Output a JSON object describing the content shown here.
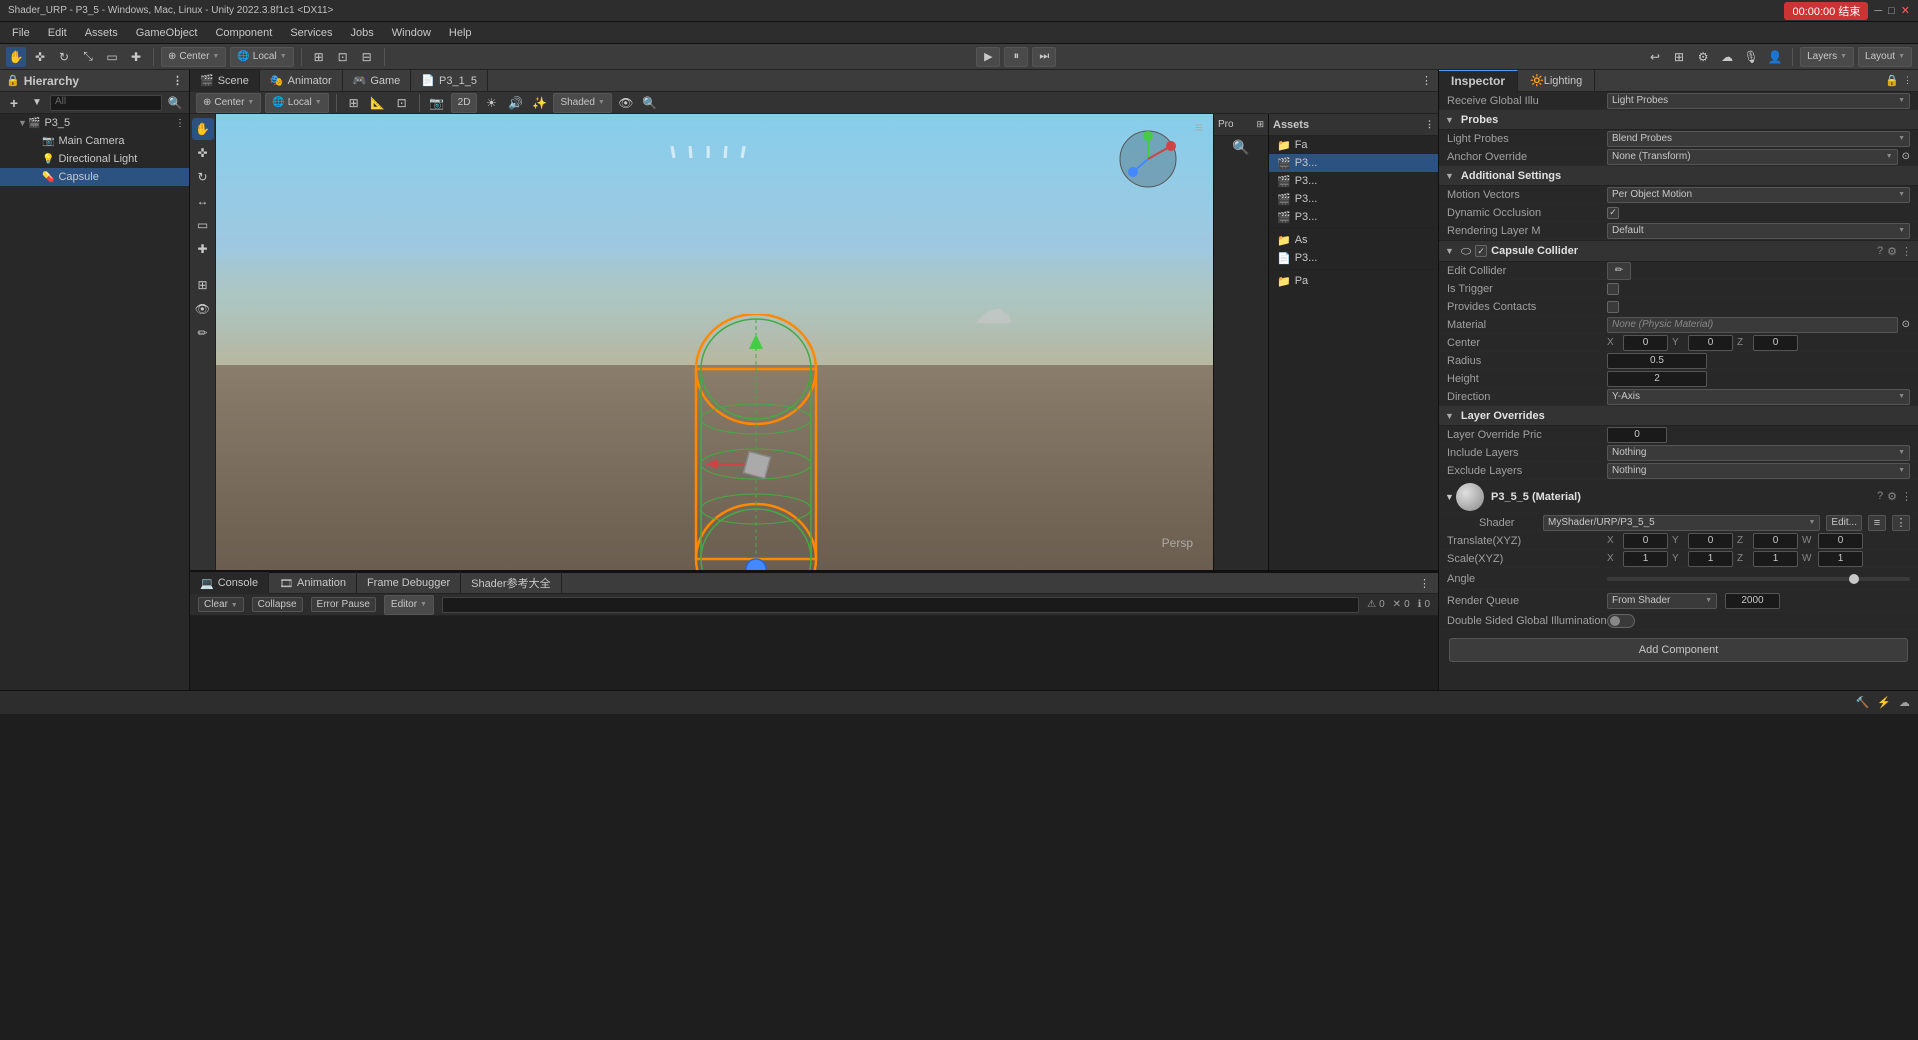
{
  "window": {
    "title": "Shader_URP - P3_5 - Windows, Mac, Linux - Unity 2022.3.8f1c1 <DX11>",
    "record_btn": "00:00:00 结束"
  },
  "menubar": {
    "items": [
      "File",
      "Edit",
      "Assets",
      "GameObject",
      "Component",
      "Services",
      "Jobs",
      "Window",
      "Help"
    ]
  },
  "toolbar": {
    "transform_tools": [
      "✏",
      "□",
      "○",
      "↗",
      "▲",
      "✚"
    ],
    "pivot": "Center",
    "coord": "Local",
    "play": "▶",
    "pause": "⏸",
    "step": "⏭",
    "layers_label": "Layers",
    "layout_label": "Layout"
  },
  "hierarchy": {
    "title": "Hierarchy",
    "search_placeholder": "All",
    "scene_name": "P3_5",
    "items": [
      {
        "name": "P3_5",
        "indent": 0,
        "expanded": true,
        "icon": "🎬"
      },
      {
        "name": "Main Camera",
        "indent": 1,
        "expanded": false,
        "icon": "📷"
      },
      {
        "name": "Directional Light",
        "indent": 1,
        "expanded": false,
        "icon": "💡"
      },
      {
        "name": "Capsule",
        "indent": 1,
        "expanded": false,
        "icon": "⬭",
        "selected": true
      }
    ]
  },
  "scene_view": {
    "tabs": [
      {
        "label": "Scene",
        "icon": "🎬",
        "active": true
      },
      {
        "label": "Animator",
        "icon": "🎭"
      },
      {
        "label": "Game",
        "icon": "🎮"
      },
      {
        "label": "P3_1_5",
        "icon": "📄"
      }
    ],
    "persp_label": "Persp",
    "view_mode": "2D",
    "gizmo_mode": "Center",
    "coord_mode": "Local"
  },
  "assets": {
    "title": "Assets",
    "items": [
      {
        "name": "Fa",
        "icon": "📁"
      },
      {
        "name": "P3...",
        "icon": "📄",
        "type": "scene"
      },
      {
        "name": "P3...",
        "icon": "📄",
        "type": "scene"
      },
      {
        "name": "P3...",
        "icon": "📄",
        "type": "scene"
      },
      {
        "name": "P3...",
        "icon": "📄",
        "type": "scene"
      },
      {
        "name": "As",
        "icon": "📁"
      },
      {
        "name": "P3...",
        "icon": "📄"
      },
      {
        "name": "Pa",
        "icon": "📁"
      }
    ]
  },
  "inspector": {
    "title": "Inspector",
    "lighting_tab": "Lighting",
    "sections": {
      "probes": {
        "title": "Probes",
        "expanded": true,
        "light_probes_label": "Light Probes",
        "light_probes_value": "Blend Probes",
        "anchor_override_label": "Anchor Override",
        "anchor_override_value": "None (Transform)"
      },
      "additional_settings": {
        "title": "Additional Settings",
        "expanded": true,
        "motion_vectors_label": "Motion Vectors",
        "motion_vectors_value": "Per Object Motion",
        "dynamic_occlusion_label": "Dynamic Occlusion",
        "dynamic_occlusion_checked": true,
        "rendering_layer_label": "Rendering Layer M",
        "rendering_layer_value": "Default"
      },
      "capsule_collider": {
        "title": "Capsule Collider",
        "expanded": true,
        "checkbox_checked": true,
        "edit_collider_label": "Edit Collider",
        "is_trigger_label": "Is Trigger",
        "is_trigger_checked": false,
        "provides_contacts_label": "Provides Contacts",
        "provides_contacts_checked": false,
        "material_label": "Material",
        "material_value": "None (Physic Material)",
        "center_label": "Center",
        "center_x": "0",
        "center_y": "0",
        "center_z": "0",
        "radius_label": "Radius",
        "radius_value": "0.5",
        "height_label": "Height",
        "height_value": "2",
        "direction_label": "Direction",
        "direction_value": "Y-Axis"
      },
      "layer_overrides": {
        "title": "Layer Overrides",
        "expanded": true,
        "layer_override_priority_label": "Layer Override Pric",
        "layer_override_priority_value": "0",
        "include_layers_label": "Include Layers",
        "include_layers_value": "Nothing",
        "exclude_layers_label": "Exclude Layers",
        "exclude_layers_value": "Nothing"
      },
      "material": {
        "name": "P3_5_5 (Material)",
        "shader_label": "Shader",
        "shader_value": "MyShader/URP/P3_5_5",
        "shader_btn1": "Edit...",
        "translate_label": "Translate(XYZ)",
        "translate_x": "0",
        "translate_y": "0",
        "translate_z": "0",
        "translate_w": "0",
        "scale_label": "Scale(XYZ)",
        "scale_x": "1",
        "scale_y": "1",
        "scale_z": "1",
        "scale_w": "1",
        "angle_label": "Angle",
        "render_queue_label": "Render Queue",
        "render_queue_mode": "From Shader",
        "render_queue_value": "2000",
        "double_sided_label": "Double Sided Global Illumination"
      }
    },
    "add_component_label": "Add Component"
  },
  "console": {
    "tabs": [
      "Console",
      "Animation",
      "Frame Debugger",
      "Shader参考大全"
    ],
    "clear_label": "Clear",
    "collapse_label": "Collapse",
    "error_pause_label": "Error Pause",
    "editor_label": "Editor",
    "count_0a": "0",
    "count_0b": "0",
    "count_0c": "0"
  },
  "status_bar": {
    "right_icons": [
      "🔨",
      "⚡",
      "☁"
    ]
  }
}
